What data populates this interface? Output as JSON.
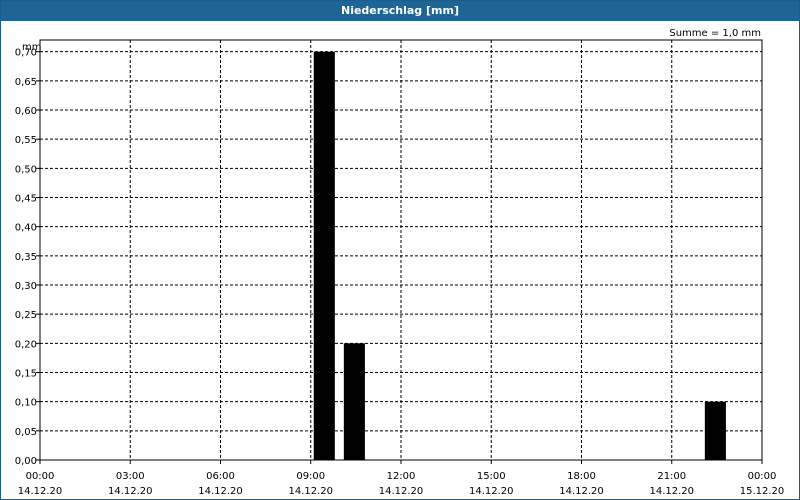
{
  "chart_data": {
    "type": "bar",
    "title": "Niederschlag [mm]",
    "ylabel": "mm",
    "sum_label": "Summe = 1,0 mm",
    "ylim": [
      0,
      0.72
    ],
    "y_ticks": [
      "0,00",
      "0,05",
      "0,10",
      "0,15",
      "0,20",
      "0,25",
      "0,30",
      "0,35",
      "0,40",
      "0,45",
      "0,50",
      "0,55",
      "0,60",
      "0,65",
      "0,70"
    ],
    "x_ticks": [
      {
        "time": "00:00",
        "date": "14.12.20"
      },
      {
        "time": "03:00",
        "date": "14.12.20"
      },
      {
        "time": "06:00",
        "date": "14.12.20"
      },
      {
        "time": "09:00",
        "date": "14.12.20"
      },
      {
        "time": "12:00",
        "date": "14.12.20"
      },
      {
        "time": "15:00",
        "date": "14.12.20"
      },
      {
        "time": "18:00",
        "date": "14.12.20"
      },
      {
        "time": "21:00",
        "date": "14.12.20"
      },
      {
        "time": "00:00",
        "date": "15.12.20"
      }
    ],
    "bars": [
      {
        "hour": "09:00",
        "value": 0.7
      },
      {
        "hour": "10:00",
        "value": 0.2
      },
      {
        "hour": "22:00",
        "value": 0.1
      }
    ],
    "grid": true,
    "bar_color": "#000000"
  }
}
